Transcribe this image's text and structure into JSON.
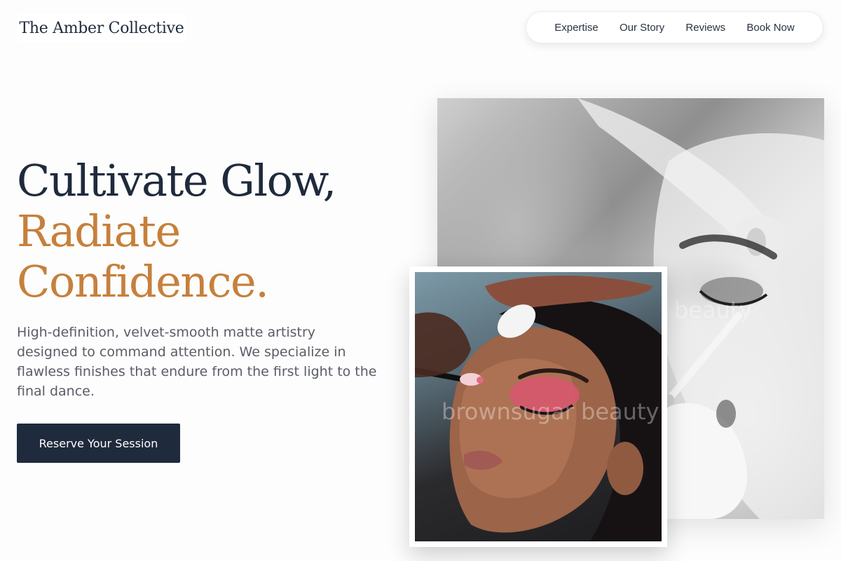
{
  "header": {
    "logo": "The Amber Collective",
    "nav": [
      {
        "label": "Expertise"
      },
      {
        "label": "Our Story"
      },
      {
        "label": "Reviews"
      },
      {
        "label": "Book Now"
      }
    ]
  },
  "hero": {
    "headline_line1": "Cultivate Glow,",
    "headline_line2": "Radiate",
    "headline_line3": "Confidence.",
    "intro": "High-definition, velvet-smooth matte artistry designed to command attention. We specialize in flawless finishes that endure from the first light to the final dance.",
    "cta_label": "Reserve Your Session"
  },
  "images": {
    "back_watermark": "beauty",
    "front_watermark": "brownsugar beauty"
  },
  "colors": {
    "navy": "#1f2a3c",
    "amber": "#c6803c",
    "body_text": "#5a5d66",
    "background": "#fdfdfd"
  }
}
